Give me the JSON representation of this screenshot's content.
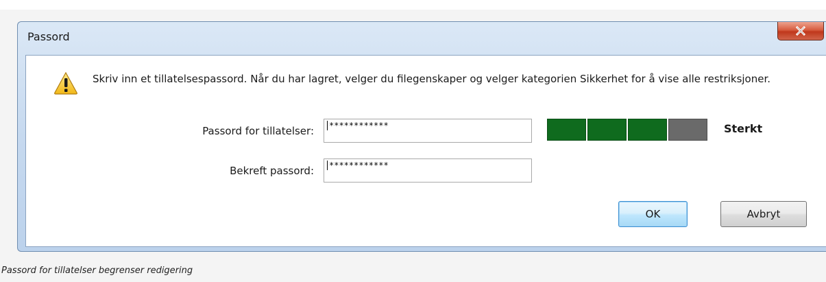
{
  "dialog": {
    "title": "Passord",
    "message": "Skriv inn et tillatelsespassord.  Når du har lagret, velger du filegenskaper og velger kategorien Sikkerhet for å vise alle restriksjoner.",
    "icons": {
      "warning": "warning-triangle-icon",
      "close": "close-x-icon"
    },
    "fields": {
      "permissions_password": {
        "label": "Passord for tillatelser:",
        "value": "************"
      },
      "confirm_password": {
        "label": "Bekreft passord:",
        "value": "************"
      }
    },
    "strength_meter": {
      "filled_segments": 3,
      "total_segments": 4,
      "label": "Sterkt",
      "filled_color": "#0f6b1e",
      "empty_color": "#6a6a6a"
    },
    "buttons": {
      "ok": "OK",
      "cancel": "Avbryt"
    }
  },
  "caption": "Passord for tillatelser begrenser redigering",
  "colors": {
    "close_button": "#c0381c",
    "window_frame": "#c6d9ef",
    "ok_border": "#3c8fd0"
  }
}
